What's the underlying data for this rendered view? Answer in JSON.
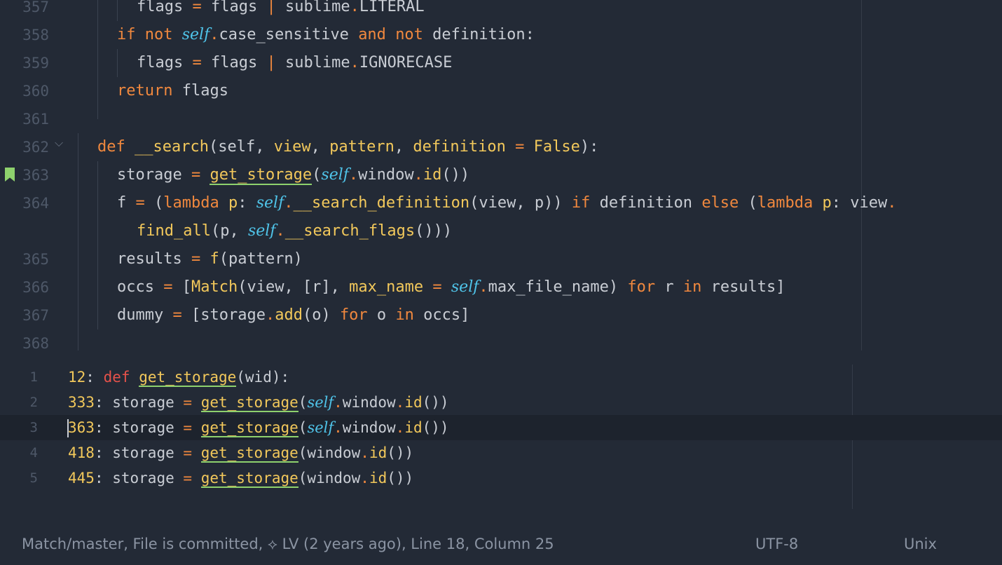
{
  "editor": {
    "lines": [
      {
        "num": "357",
        "tokens": [
          [
            "t",
            "flags "
          ],
          [
            "op",
            "="
          ],
          [
            "t",
            " flags "
          ],
          [
            "op",
            "|"
          ],
          [
            "t",
            " sublime"
          ],
          [
            "op",
            "."
          ],
          [
            "t",
            "LITERAL"
          ]
        ]
      },
      {
        "num": "358",
        "tokens": [
          [
            "kw",
            "if"
          ],
          [
            "t",
            " "
          ],
          [
            "kw",
            "not"
          ],
          [
            "t",
            " "
          ],
          [
            "self",
            "self"
          ],
          [
            "op",
            "."
          ],
          [
            "t",
            "case_sensitive "
          ],
          [
            "kw",
            "and"
          ],
          [
            "t",
            " "
          ],
          [
            "kw",
            "not"
          ],
          [
            "t",
            " definition:"
          ]
        ]
      },
      {
        "num": "359",
        "tokens": [
          [
            "t",
            "flags "
          ],
          [
            "op",
            "="
          ],
          [
            "t",
            " flags "
          ],
          [
            "op",
            "|"
          ],
          [
            "t",
            " sublime"
          ],
          [
            "op",
            "."
          ],
          [
            "t",
            "IGNORECASE"
          ]
        ]
      },
      {
        "num": "360",
        "tokens": [
          [
            "kw",
            "return"
          ],
          [
            "t",
            " flags"
          ]
        ]
      },
      {
        "num": "361",
        "tokens": []
      },
      {
        "num": "362",
        "tokens": [
          [
            "kw",
            "def"
          ],
          [
            "t",
            " "
          ],
          [
            "fn",
            "__search"
          ],
          [
            "t",
            "(self, "
          ],
          [
            "param",
            "view"
          ],
          [
            "t",
            ", "
          ],
          [
            "param",
            "pattern"
          ],
          [
            "t",
            ", "
          ],
          [
            "param",
            "definition"
          ],
          [
            "t",
            " "
          ],
          [
            "op",
            "="
          ],
          [
            "t",
            " "
          ],
          [
            "const",
            "False"
          ],
          [
            "t",
            "):"
          ]
        ]
      },
      {
        "num": "363",
        "tokens": [
          [
            "t",
            "storage "
          ],
          [
            "op",
            "="
          ],
          [
            "t",
            " "
          ],
          [
            "fnu",
            "get_storage"
          ],
          [
            "t",
            "("
          ],
          [
            "self",
            "self"
          ],
          [
            "op",
            "."
          ],
          [
            "t",
            "window"
          ],
          [
            "op",
            "."
          ],
          [
            "fn",
            "id"
          ],
          [
            "t",
            "())"
          ]
        ]
      },
      {
        "num": "364",
        "tokens": [
          [
            "t",
            "f "
          ],
          [
            "op",
            "="
          ],
          [
            "t",
            " ("
          ],
          [
            "kw",
            "lambda"
          ],
          [
            "t",
            " "
          ],
          [
            "param",
            "p"
          ],
          [
            "t",
            ": "
          ],
          [
            "self",
            "self"
          ],
          [
            "op",
            "."
          ],
          [
            "fn",
            "__search_definition"
          ],
          [
            "t",
            "(view, p)) "
          ],
          [
            "kw",
            "if"
          ],
          [
            "t",
            " definition "
          ],
          [
            "kw",
            "else"
          ],
          [
            "t",
            " ("
          ],
          [
            "kw",
            "lambda"
          ],
          [
            "t",
            " "
          ],
          [
            "param",
            "p"
          ],
          [
            "t",
            ": view"
          ],
          [
            "op",
            "."
          ]
        ]
      },
      {
        "num": "",
        "tokens": [
          [
            "fn",
            "find_all"
          ],
          [
            "t",
            "(p, "
          ],
          [
            "self",
            "self"
          ],
          [
            "op",
            "."
          ],
          [
            "fn",
            "__search_flags"
          ],
          [
            "t",
            "()))"
          ]
        ]
      },
      {
        "num": "365",
        "tokens": [
          [
            "t",
            "results "
          ],
          [
            "op",
            "="
          ],
          [
            "t",
            " "
          ],
          [
            "fn",
            "f"
          ],
          [
            "t",
            "(pattern)"
          ]
        ]
      },
      {
        "num": "366",
        "tokens": [
          [
            "t",
            "occs "
          ],
          [
            "op",
            "="
          ],
          [
            "t",
            " ["
          ],
          [
            "fn",
            "Match"
          ],
          [
            "t",
            "(view, [r], "
          ],
          [
            "param",
            "max_name"
          ],
          [
            "t",
            " "
          ],
          [
            "op",
            "="
          ],
          [
            "t",
            " "
          ],
          [
            "self",
            "self"
          ],
          [
            "op",
            "."
          ],
          [
            "t",
            "max_file_name) "
          ],
          [
            "kw",
            "for"
          ],
          [
            "t",
            " r "
          ],
          [
            "kw",
            "in"
          ],
          [
            "t",
            " results]"
          ]
        ]
      },
      {
        "num": "367",
        "tokens": [
          [
            "t",
            "dummy "
          ],
          [
            "op",
            "="
          ],
          [
            "t",
            " [storage"
          ],
          [
            "op",
            "."
          ],
          [
            "fn",
            "add"
          ],
          [
            "t",
            "(o) "
          ],
          [
            "kw",
            "for"
          ],
          [
            "t",
            " o "
          ],
          [
            "kw",
            "in"
          ],
          [
            "t",
            " occs]"
          ]
        ]
      },
      {
        "num": "368",
        "tokens": []
      }
    ]
  },
  "results": {
    "rows": [
      {
        "num": "1",
        "ref": "12",
        "tokens": [
          [
            "defkw",
            "def"
          ],
          [
            "t",
            " "
          ],
          [
            "fnu",
            "get_storage"
          ],
          [
            "t",
            "(wid):"
          ]
        ]
      },
      {
        "num": "2",
        "ref": "333",
        "tokens": [
          [
            "t",
            "storage "
          ],
          [
            "op",
            "="
          ],
          [
            "t",
            " "
          ],
          [
            "fnu",
            "get_storage"
          ],
          [
            "t",
            "("
          ],
          [
            "self",
            "self"
          ],
          [
            "op",
            "."
          ],
          [
            "t",
            "window"
          ],
          [
            "op",
            "."
          ],
          [
            "fn",
            "id"
          ],
          [
            "t",
            "())"
          ]
        ]
      },
      {
        "num": "3",
        "ref": "363",
        "tokens": [
          [
            "t",
            "storage "
          ],
          [
            "op",
            "="
          ],
          [
            "t",
            " "
          ],
          [
            "fnu",
            "get_storage"
          ],
          [
            "t",
            "("
          ],
          [
            "self",
            "self"
          ],
          [
            "op",
            "."
          ],
          [
            "t",
            "window"
          ],
          [
            "op",
            "."
          ],
          [
            "fn",
            "id"
          ],
          [
            "t",
            "())"
          ]
        ]
      },
      {
        "num": "4",
        "ref": "418",
        "tokens": [
          [
            "t",
            "storage "
          ],
          [
            "op",
            "="
          ],
          [
            "t",
            " "
          ],
          [
            "fnu",
            "get_storage"
          ],
          [
            "t",
            "(window"
          ],
          [
            "op",
            "."
          ],
          [
            "fn",
            "id"
          ],
          [
            "t",
            "())"
          ]
        ]
      },
      {
        "num": "5",
        "ref": "445",
        "tokens": [
          [
            "t",
            "storage "
          ],
          [
            "op",
            "="
          ],
          [
            "t",
            " "
          ],
          [
            "fnu",
            "get_storage"
          ],
          [
            "t",
            "(window"
          ],
          [
            "op",
            "."
          ],
          [
            "fn",
            "id"
          ],
          [
            "t",
            "())"
          ]
        ]
      }
    ]
  },
  "status": {
    "left": "Match/master, File is committed, ⟡ LV (2 years ago), Line 18, Column 25",
    "encoding": "UTF-8",
    "line_endings": "Unix"
  },
  "colors": {
    "background": "#232a36",
    "keyword": "#f0883e",
    "function": "#f2c85b",
    "self": "#4fc3e8",
    "def_keyword_results": "#e5524a",
    "bookmark": "#8ed16d"
  }
}
